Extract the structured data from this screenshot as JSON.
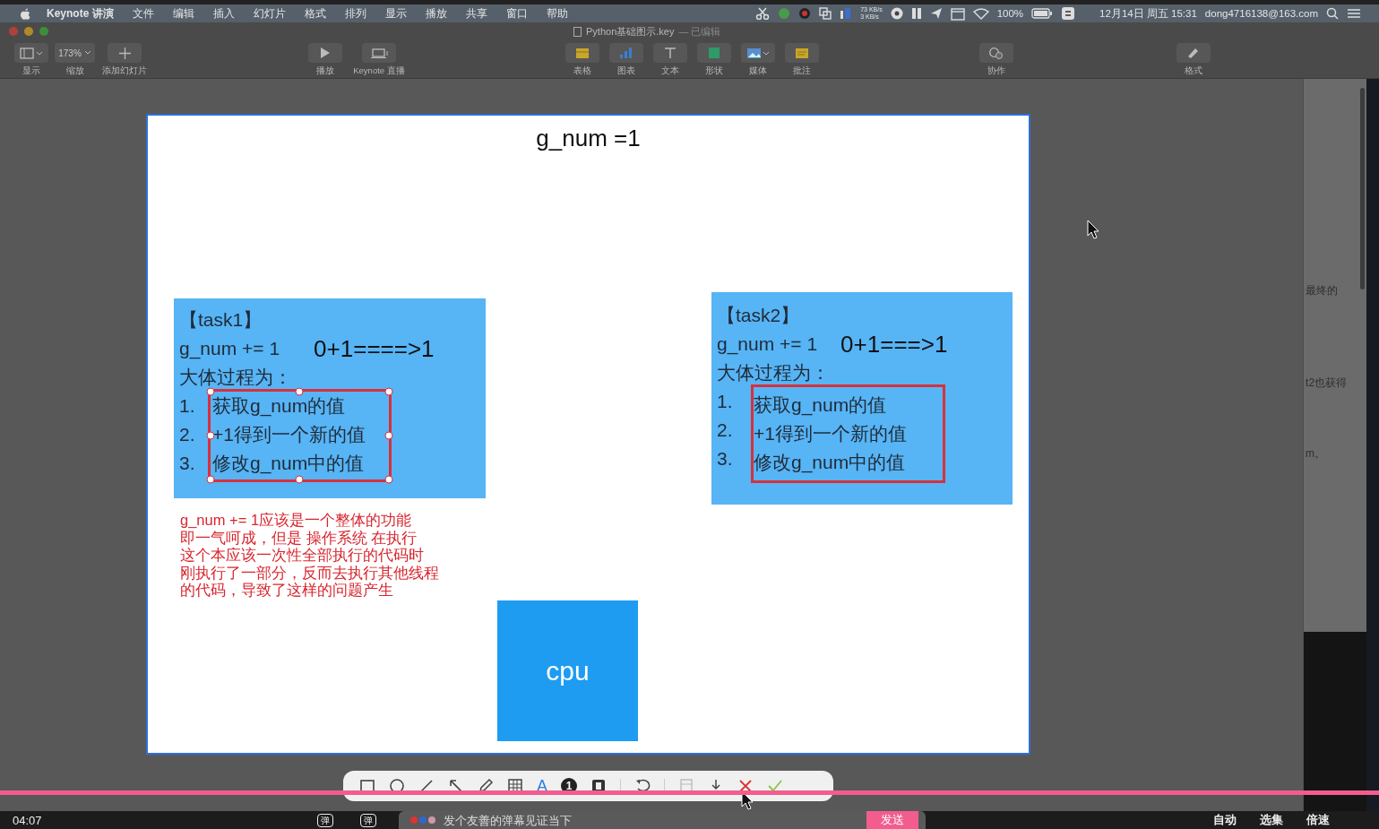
{
  "menu_bar": {
    "app": "Keynote 讲演",
    "menus": [
      "文件",
      "编辑",
      "插入",
      "幻灯片",
      "格式",
      "排列",
      "显示",
      "播放",
      "共享",
      "窗口",
      "帮助"
    ],
    "status": {
      "net_up": "73 KB/s",
      "net_down": "3 KB/s",
      "battery": "100%",
      "datetime": "12月14日 周五 15:31",
      "account": "dong4716138@163.com"
    }
  },
  "window": {
    "title": "Python基础图示.key",
    "subtitle": "— 已编辑"
  },
  "toolbar": [
    {
      "kind": "view",
      "label": "显示"
    },
    {
      "kind": "zoom",
      "label": "缩放",
      "value": "173%"
    },
    {
      "kind": "add",
      "label": "添加幻灯片"
    },
    {
      "kind": "play",
      "label": "播放"
    },
    {
      "kind": "live",
      "label": "Keynote 直播"
    },
    {
      "kind": "table",
      "label": "表格"
    },
    {
      "kind": "chart",
      "label": "图表"
    },
    {
      "kind": "text",
      "label": "文本"
    },
    {
      "kind": "shape",
      "label": "形状"
    },
    {
      "kind": "media",
      "label": "媒体"
    },
    {
      "kind": "comment",
      "label": "批注"
    },
    {
      "kind": "collaborate",
      "label": "协作"
    },
    {
      "kind": "format",
      "label": "格式"
    }
  ],
  "slide": {
    "title": "g_num =1",
    "tasks": [
      {
        "label": "【task1】",
        "code": "g_num += 1",
        "result": "0+1====>1",
        "heading": "大体过程为：",
        "selected": true,
        "steps": [
          {
            "number": "1.",
            "text": "获取g_num的值"
          },
          {
            "number": "2.",
            "text": "+1得到一个新的值"
          },
          {
            "number": "3.",
            "text": "修改g_num中的值"
          }
        ]
      },
      {
        "label": "【task2】",
        "code": "g_num += 1",
        "result": "0+1===>1",
        "heading": "大体过程为：",
        "selected": false,
        "steps": [
          {
            "number": "1.",
            "text": "获取g_num的值"
          },
          {
            "number": "2.",
            "text": "+1得到一个新的值"
          },
          {
            "number": "3.",
            "text": "修改g_num中的值"
          }
        ]
      }
    ],
    "note": [
      "g_num += 1应该是一个整体的功能",
      "即一气呵成，但是 操作系统 在执行",
      "这个本应该一次性全部执行的代码时",
      "刚执行了一部分，反而去执行其他线程",
      "的代码，导致了这样的问题产生"
    ],
    "cpu": "cpu"
  },
  "side_panel": {
    "texts": [
      "最终的",
      "t2也获得",
      "m。"
    ]
  },
  "annotation_toolbar": [
    {
      "kind": "rect"
    },
    {
      "kind": "ellipse"
    },
    {
      "kind": "line"
    },
    {
      "kind": "arrow"
    },
    {
      "kind": "pen"
    },
    {
      "kind": "mosaic"
    },
    {
      "kind": "text",
      "glyph": "A"
    },
    {
      "kind": "number",
      "glyph": "1"
    },
    {
      "kind": "frame"
    },
    {
      "kind": "undo"
    },
    {
      "kind": "save"
    },
    {
      "kind": "download"
    },
    {
      "kind": "cancel"
    },
    {
      "kind": "confirm"
    }
  ],
  "player": {
    "level": 1,
    "time": "04:07",
    "danmaku_toggles": [
      "弹",
      "弹"
    ],
    "danmaku_placeholder": "发个友善的弹幕见证当下",
    "send": "发送",
    "controls": [
      "自动",
      "选集",
      "倍速"
    ]
  }
}
